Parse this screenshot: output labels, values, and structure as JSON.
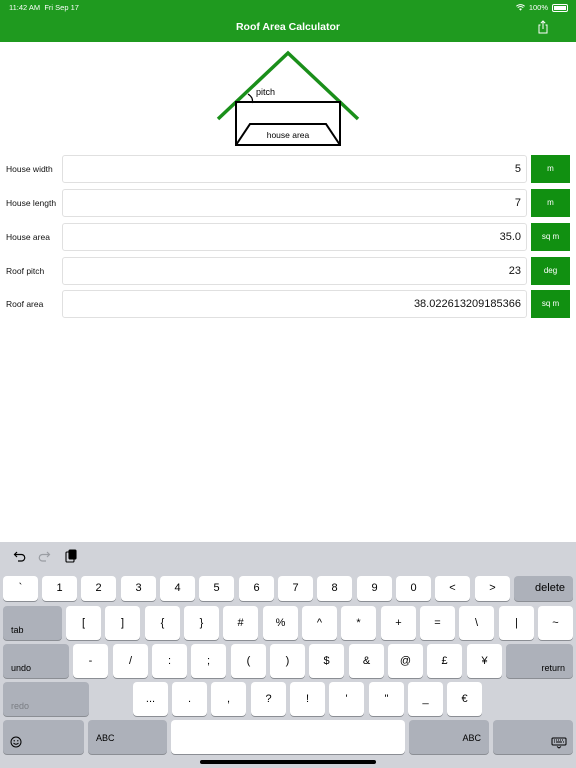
{
  "status": {
    "time": "11:42 AM",
    "date": "Fri Sep 17",
    "battery": "100%"
  },
  "header": {
    "title": "Roof Area Calculator",
    "share_icon": "share-icon"
  },
  "diagram": {
    "pitch_label": "pitch",
    "house_label": "house area"
  },
  "rows": [
    {
      "label": "House width",
      "value": "5",
      "unit": "m"
    },
    {
      "label": "House length",
      "value": "7",
      "unit": "m"
    },
    {
      "label": "House area",
      "value": "35.0",
      "unit": "sq m"
    },
    {
      "label": "Roof pitch",
      "value": "23",
      "unit": "deg"
    },
    {
      "label": "Roof area",
      "value": "38.022613209185366",
      "unit": "sq m"
    }
  ],
  "keyboard": {
    "row1": [
      "`",
      "1",
      "2",
      "3",
      "4",
      "5",
      "6",
      "7",
      "8",
      "9",
      "0",
      "<",
      ">"
    ],
    "delete": "delete",
    "tab": "tab",
    "row2": [
      "[",
      "]",
      "{",
      "}",
      "#",
      "%",
      "^",
      "*",
      "+",
      "=",
      "\\",
      "|",
      "~"
    ],
    "undo": "undo",
    "row3": [
      "-",
      "/",
      ":",
      ";",
      "(",
      ")",
      "$",
      "&",
      "@",
      "£",
      "¥"
    ],
    "return": "return",
    "redo": "redo",
    "row4": [
      "...",
      ".",
      ",",
      "?",
      "!",
      "'",
      "\"",
      "_",
      "€"
    ],
    "abc_left": "ABC",
    "abc_right": "ABC"
  },
  "colors": {
    "accent": "#1f9a1f",
    "unit_button": "#119011"
  }
}
